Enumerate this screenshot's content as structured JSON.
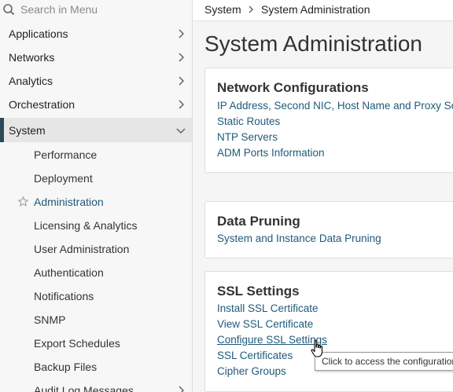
{
  "search": {
    "placeholder": "Search in Menu"
  },
  "sidebar": {
    "top_items": [
      {
        "label": "Applications"
      },
      {
        "label": "Networks"
      },
      {
        "label": "Analytics"
      },
      {
        "label": "Orchestration"
      }
    ],
    "active_item": {
      "label": "System"
    },
    "sub_items": [
      {
        "label": "Performance"
      },
      {
        "label": "Deployment"
      },
      {
        "label": "Administration"
      },
      {
        "label": "Licensing & Analytics"
      },
      {
        "label": "User Administration"
      },
      {
        "label": "Authentication"
      },
      {
        "label": "Notifications"
      },
      {
        "label": "SNMP"
      },
      {
        "label": "Export Schedules"
      },
      {
        "label": "Backup Files"
      },
      {
        "label": "Audit Log Messages"
      }
    ]
  },
  "breadcrumb": {
    "first": "System",
    "second": "System Administration"
  },
  "main": {
    "title": "System Administration",
    "network": {
      "title": "Network Configurations",
      "links": [
        "IP Address, Second NIC, Host Name and Proxy Server",
        "Static Routes",
        "NTP Servers",
        "ADM Ports Information"
      ]
    },
    "pruning": {
      "title": "Data Pruning",
      "links": [
        "System and Instance Data Pruning"
      ]
    },
    "ssl": {
      "title": "SSL Settings",
      "links": [
        "Install SSL Certificate",
        "View SSL Certificate",
        "Configure SSL Settings",
        "SSL Certificates",
        "Cipher Groups"
      ]
    }
  },
  "tooltip": {
    "text": "Click to access the configuration"
  },
  "colors": {
    "link": "#1f5a7a",
    "active_bar": "#2c4a5a"
  },
  "icons": [
    "search-icon",
    "chevron-right-icon",
    "chevron-down-icon",
    "star-icon",
    "hand-cursor-icon"
  ]
}
